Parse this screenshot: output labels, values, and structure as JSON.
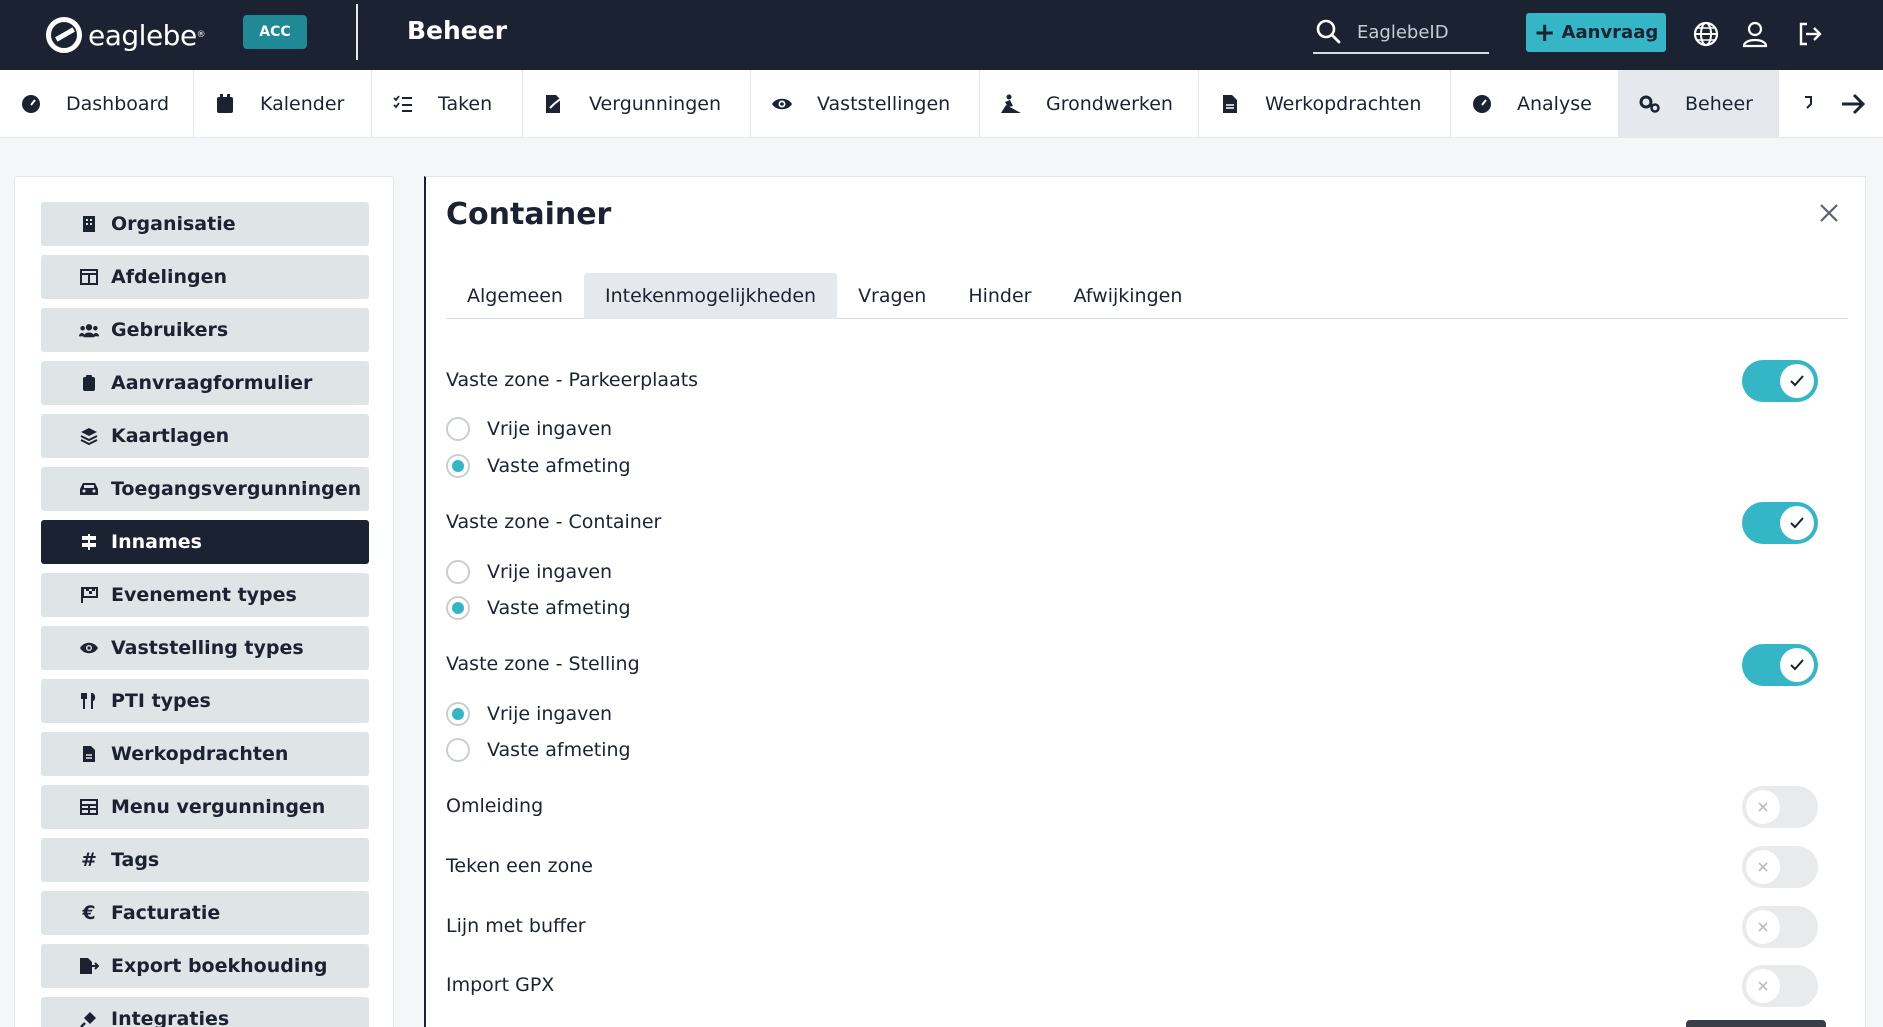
{
  "topbar": {
    "logo_text": "eaglebe",
    "logo_tm": "®",
    "env_badge": "ACC",
    "app_title": "Beheer",
    "search_placeholder": "EaglebeID",
    "new_button_label": "Aanvraag",
    "icons": [
      "search-icon",
      "plus-icon",
      "globe-icon",
      "user-icon",
      "logout-icon"
    ]
  },
  "nav": {
    "items": [
      {
        "label": "Dashboard",
        "icon": "dashboard-icon"
      },
      {
        "label": "Kalender",
        "icon": "calendar-icon"
      },
      {
        "label": "Taken",
        "icon": "tasks-icon"
      },
      {
        "label": "Vergunningen",
        "icon": "permit-icon"
      },
      {
        "label": "Vaststellingen",
        "icon": "eye-icon"
      },
      {
        "label": "Grondwerken",
        "icon": "digger-icon"
      },
      {
        "label": "Werkopdrachten",
        "icon": "document-icon"
      },
      {
        "label": "Analyse",
        "icon": "gauge-icon"
      },
      {
        "label": "Beheer",
        "icon": "cogs-icon",
        "active": true
      }
    ],
    "next_icon": "arrow-right-icon"
  },
  "sidebar": {
    "items": [
      {
        "label": "Organisatie",
        "icon": "building-icon"
      },
      {
        "label": "Afdelingen",
        "icon": "columns-icon"
      },
      {
        "label": "Gebruikers",
        "icon": "users-icon"
      },
      {
        "label": "Aanvraagformulier",
        "icon": "clipboard-icon"
      },
      {
        "label": "Kaartlagen",
        "icon": "layers-icon"
      },
      {
        "label": "Toegangsvergunningen",
        "icon": "car-icon"
      },
      {
        "label": "Innames",
        "icon": "signpost-icon",
        "active": true
      },
      {
        "label": "Evenement types",
        "icon": "flag-checkered-icon"
      },
      {
        "label": "Vaststelling types",
        "icon": "eye-icon"
      },
      {
        "label": "PTI types",
        "icon": "utensils-icon"
      },
      {
        "label": "Werkopdrachten",
        "icon": "document-icon"
      },
      {
        "label": "Menu vergunningen",
        "icon": "table-icon"
      },
      {
        "label": "Tags",
        "icon": "hashtag-icon"
      },
      {
        "label": "Facturatie",
        "icon": "euro-icon"
      },
      {
        "label": "Export boekhouding",
        "icon": "file-export-icon"
      },
      {
        "label": "Integraties",
        "icon": "plug-icon"
      }
    ]
  },
  "panel": {
    "title": "Container",
    "tabs": [
      {
        "label": "Algemeen"
      },
      {
        "label": "Intekenmogelijkheden",
        "active": true
      },
      {
        "label": "Vragen"
      },
      {
        "label": "Hinder"
      },
      {
        "label": "Afwijkingen"
      }
    ],
    "sections": [
      {
        "label": "Vaste zone - Parkeerplaats",
        "enabled": true,
        "options": [
          {
            "label": "Vrije ingaven",
            "checked": false
          },
          {
            "label": "Vaste afmeting",
            "checked": true
          }
        ]
      },
      {
        "label": "Vaste zone - Container",
        "enabled": true,
        "options": [
          {
            "label": "Vrije ingaven",
            "checked": false
          },
          {
            "label": "Vaste afmeting",
            "checked": true
          }
        ]
      },
      {
        "label": "Vaste zone - Stelling",
        "enabled": true,
        "options": [
          {
            "label": "Vrije ingaven",
            "checked": true
          },
          {
            "label": "Vaste afmeting",
            "checked": false
          }
        ]
      },
      {
        "label": "Omleiding",
        "enabled": false
      },
      {
        "label": "Teken een zone",
        "enabled": false
      },
      {
        "label": "Lijn met buffer",
        "enabled": false
      },
      {
        "label": "Import GPX",
        "enabled": false
      }
    ]
  },
  "colors": {
    "topbar_bg": "#1b2333",
    "accent": "#35b6c7",
    "badge_bg": "#1f8a96",
    "sidebar_item_bg": "#dfe4e7",
    "active_nav_bg": "#e5e9ed"
  }
}
